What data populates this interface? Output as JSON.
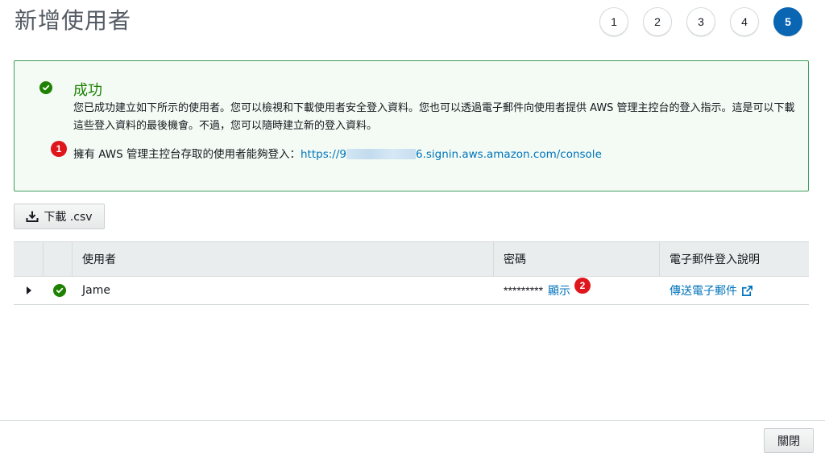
{
  "page": {
    "title": "新增使用者"
  },
  "steps": [
    "1",
    "2",
    "3",
    "4",
    "5"
  ],
  "alert": {
    "title": "成功",
    "body": "您已成功建立如下所示的使用者。您可以檢視和下載使用者安全登入資料。您也可以透過電子郵件向使用者提供 AWS 管理主控台的登入指示。這是可以下載這些登入資料的最後機會。不過，您可以隨時建立新的登入資料。",
    "login_prefix": "擁有 AWS 管理主控台存取的使用者能夠登入：",
    "login_url_start": "https://9",
    "login_url_end": "6.signin.aws.amazon.com/console",
    "badge": "1"
  },
  "toolbar": {
    "download_label": "下載 .csv"
  },
  "table": {
    "headers": [
      "使用者",
      "密碼",
      "電子郵件登入說明"
    ],
    "rows": [
      {
        "user": "Jame",
        "password_mask": "*********",
        "show_label": "顯示",
        "email_label": "傳送電子郵件",
        "badge": "2"
      }
    ]
  },
  "footer": {
    "close_label": "關閉"
  },
  "colors": {
    "success": "#1d8102",
    "link": "#0073bb",
    "active_step": "#0a66b2",
    "badge": "#e0161d"
  }
}
